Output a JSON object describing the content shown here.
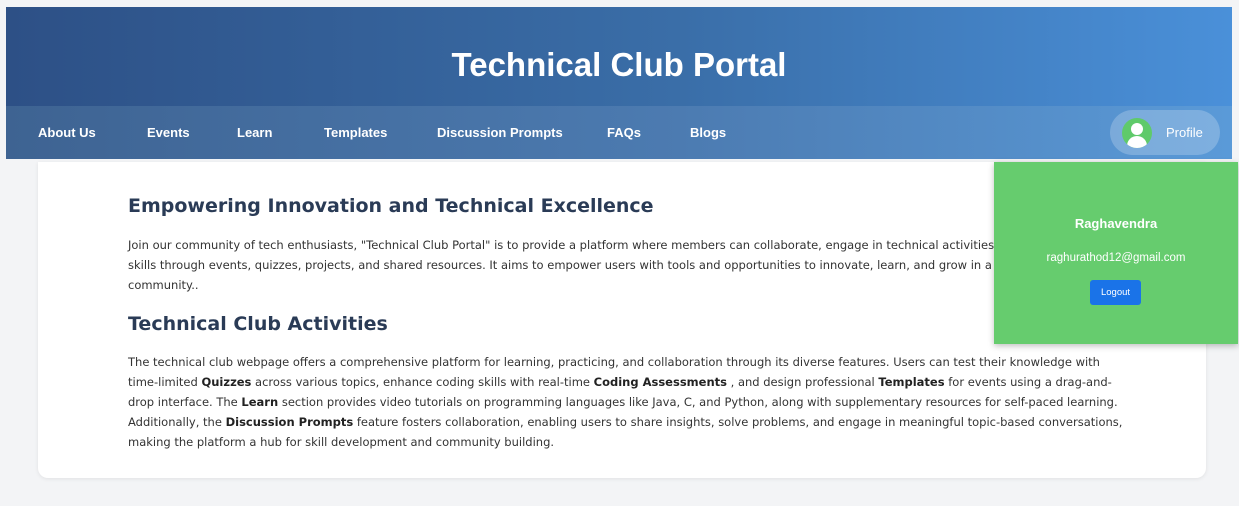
{
  "header": {
    "title": "Technical Club Portal"
  },
  "nav": {
    "items": [
      "About Us",
      "Events",
      "Learn",
      "Templates",
      "Discussion Prompts",
      "FAQs",
      "Blogs"
    ],
    "profile_label": "Profile"
  },
  "main": {
    "heading1": "Empowering Innovation and Technical Excellence",
    "para1": "Join our community of tech enthusiasts, \"Technical Club Portal\" is to provide a platform where members can collaborate, engage in technical activities, and enhance their skills through events, quizzes, projects, and shared resources. It aims to empower users with tools and opportunities to innovate, learn, and grow in a collaborative community..",
    "heading2": "Technical Club Activities",
    "para2": {
      "t1": "The technical club webpage offers a comprehensive platform for learning, practicing, and collaboration through its diverse features. Users can test their knowledge with time-limited ",
      "b1": "Quizzes",
      "t2": " across various topics, enhance coding skills with real-time ",
      "b2": "Coding Assessments",
      "t3": " , and design professional ",
      "b3": "Templates",
      "t4": " for events using a drag-and-drop interface. The ",
      "b4": "Learn",
      "t5": " section provides video tutorials on programming languages like Java, C, and Python, along with supplementary resources for self-paced learning. Additionally, the ",
      "b5": "Discussion Prompts",
      "t6": " feature fosters collaboration, enabling users to share insights, solve problems, and engage in meaningful topic-based conversations, making the platform a hub for skill development and community building."
    }
  },
  "profile_dropdown": {
    "name": "Raghavendra",
    "email": "raghurathod12@gmail.com",
    "logout_label": "Logout"
  },
  "colors": {
    "header_start": "#2d5086",
    "header_end": "#4a90d9",
    "dropdown_bg": "#66cc6e",
    "logout_bg": "#1a73e8"
  }
}
